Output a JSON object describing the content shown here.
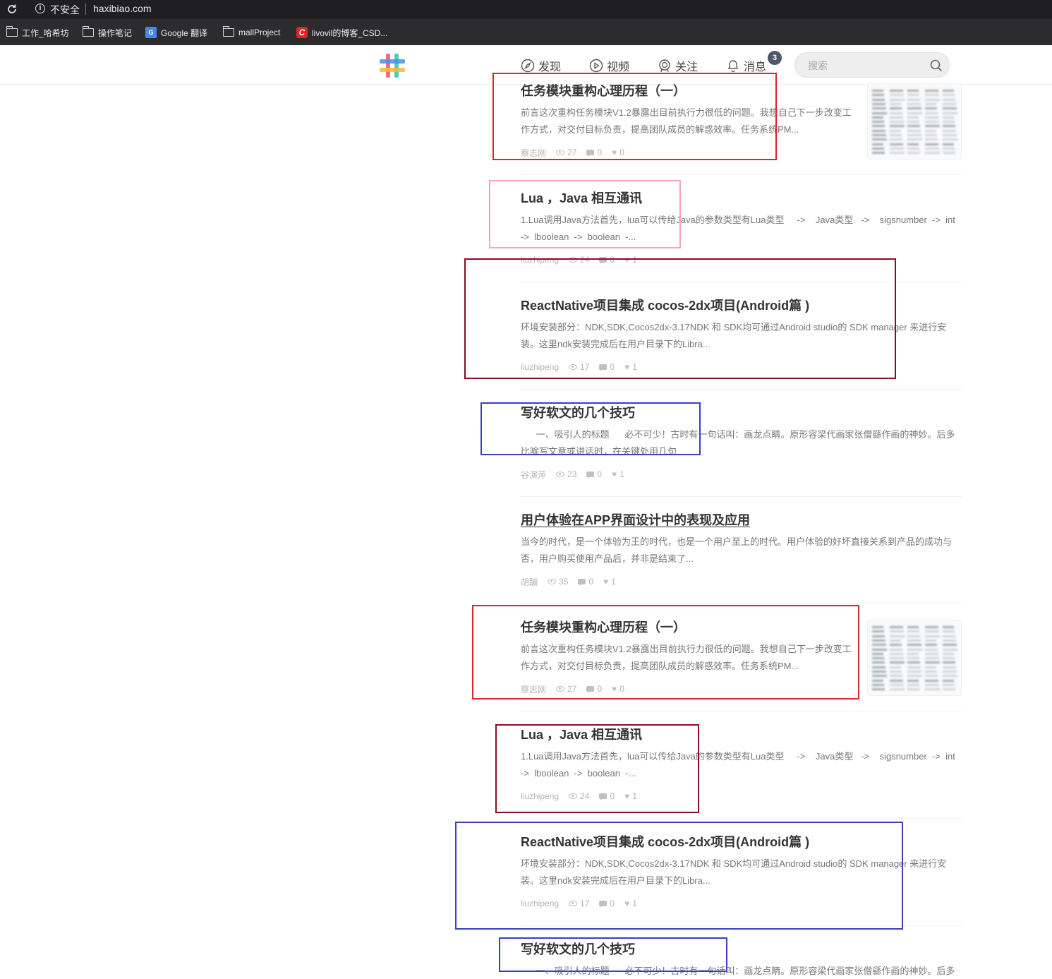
{
  "browser": {
    "security_label": "不安全",
    "url": "haxibiao.com",
    "bookmarks": [
      {
        "label": "工作_哈希坊",
        "icon": "folder-icon"
      },
      {
        "label": "操作笔记",
        "icon": "folder-icon"
      },
      {
        "label": "Google 翻译",
        "icon": "google-translate-icon"
      },
      {
        "label": "mallProject",
        "icon": "folder-icon"
      },
      {
        "label": "livovil的博客_CSD...",
        "icon": "csdn-icon"
      }
    ]
  },
  "header": {
    "nav": [
      {
        "label": "发现",
        "icon": "compass-icon"
      },
      {
        "label": "视频",
        "icon": "play-icon"
      },
      {
        "label": "关注",
        "icon": "badge-icon"
      },
      {
        "label": "消息",
        "icon": "bell-icon"
      }
    ],
    "message_count": "3",
    "search_placeholder": "搜索"
  },
  "articles": [
    {
      "title": "任务模块重构心理历程（一）",
      "abstract": "前言这次重构任务模块V1.2暴露出目前执行力很低的问题。我想自己下一步改变工作方式，对交付目标负责，提高团队成员的解惑效率。任务系统PM...",
      "author": "蔡志刚",
      "views": "27",
      "comments": "0",
      "likes": "0",
      "has_thumb": true
    },
    {
      "title": "Lua ，Java 相互通讯",
      "abstract": "1.Lua调用Java方法首先，lua可以传给Java的参数类型有Lua类型     ->    Java类型   ->    sigsnumber  ->  int  ->  lboolean  ->  boolean  -...",
      "author": "liuzhipeng",
      "views": "24",
      "comments": "0",
      "likes": "1",
      "has_thumb": false
    },
    {
      "title": "ReactNative项目集成 cocos-2dx项目(Android篇 )",
      "abstract": "环境安装部分：NDK,SDK,Cocos2dx-3.17NDK 和 SDK均可通过Android studio的 SDK manager 来进行安装。这里ndk安装完成后在用户目录下的Libra...",
      "author": "liuzhipeng",
      "views": "17",
      "comments": "0",
      "likes": "1",
      "has_thumb": false
    },
    {
      "title": "写好软文的几个技巧",
      "abstract": "      一、吸引人的标题      必不可少！古时有一句话叫：画龙点睛。原形容梁代画家张僧繇作画的神妙。后多比喻写文章或讲话时，在关键处用几句",
      "author": "谷演萍",
      "views": "23",
      "comments": "0",
      "likes": "1",
      "has_thumb": false
    },
    {
      "title": "用户体验在APP界面设计中的表现及应用",
      "abstract": "当今的时代，是一个体验为王的时代，也是一个用户至上的时代。用户体验的好坏直接关系到产品的成功与否，用户购买使用产品后，并非是结束了...",
      "author": "胡蹦",
      "views": "35",
      "comments": "0",
      "likes": "1",
      "has_thumb": false
    },
    {
      "title": "任务模块重构心理历程（一）",
      "abstract": "前言这次重构任务模块V1.2暴露出目前执行力很低的问题。我想自己下一步改变工作方式，对交付目标负责，提高团队成员的解惑效率。任务系统PM...",
      "author": "蔡志刚",
      "views": "27",
      "comments": "0",
      "likes": "0",
      "has_thumb": true
    },
    {
      "title": "Lua ，Java 相互通讯",
      "abstract": "1.Lua调用Java方法首先，lua可以传给Java的参数类型有Lua类型     ->    Java类型   ->    sigsnumber  ->  int  ->  lboolean  ->  boolean  -...",
      "author": "liuzhipeng",
      "views": "24",
      "comments": "0",
      "likes": "1",
      "has_thumb": false
    },
    {
      "title": "ReactNative项目集成 cocos-2dx项目(Android篇 )",
      "abstract": "环境安装部分：NDK,SDK,Cocos2dx-3.17NDK 和 SDK均可通过Android studio的 SDK manager 来进行安装。这里ndk安装完成后在用户目录下的Libra...",
      "author": "liuzhipeng",
      "views": "17",
      "comments": "0",
      "likes": "1",
      "has_thumb": false
    },
    {
      "title": "写好软文的几个技巧",
      "abstract": "      一、吸引人的标题      必不可少！古时有一句话叫：画龙点睛。原形容梁代画家张僧繇作画的神妙。后多",
      "author": "",
      "views": "",
      "comments": "",
      "likes": "",
      "has_thumb": false
    }
  ],
  "annotation_colors": [
    "#d9262c",
    "#f4a3c0",
    "#8b0d22",
    "#3a3fbf",
    "#d9262c",
    "#8b0d22",
    "#3a3fbf",
    "#3a3fbf"
  ]
}
